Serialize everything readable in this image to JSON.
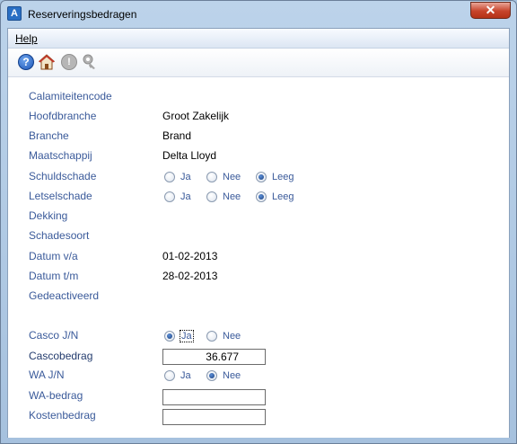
{
  "window": {
    "title": "Reserveringsbedragen",
    "close_label": "✕"
  },
  "menu": {
    "help_label": "Help"
  },
  "toolbar": {
    "icons": [
      "help-icon",
      "home-icon",
      "info-icon",
      "key-icon"
    ]
  },
  "form": {
    "calamiteitencode": {
      "label": "Calamiteitencode",
      "value": ""
    },
    "hoofdbranche": {
      "label": "Hoofdbranche",
      "value": "Groot Zakelijk"
    },
    "branche": {
      "label": "Branche",
      "value": "Brand"
    },
    "maatschappij": {
      "label": "Maatschappij",
      "value": "Delta Lloyd"
    },
    "schuldschade": {
      "label": "Schuldschade",
      "options": [
        "Ja",
        "Nee",
        "Leeg"
      ],
      "selected": "Leeg"
    },
    "letselschade": {
      "label": "Letselschade",
      "options": [
        "Ja",
        "Nee",
        "Leeg"
      ],
      "selected": "Leeg"
    },
    "dekking": {
      "label": "Dekking",
      "value": ""
    },
    "schadesoort": {
      "label": "Schadesoort",
      "value": ""
    },
    "datum_va": {
      "label": "Datum v/a",
      "value": "01-02-2013"
    },
    "datum_tm": {
      "label": "Datum t/m",
      "value": "28-02-2013"
    },
    "gedeactiveerd": {
      "label": "Gedeactiveerd",
      "value": ""
    },
    "casco_jn": {
      "label": "Casco J/N",
      "options": [
        "Ja",
        "Nee"
      ],
      "selected": "Ja"
    },
    "cascobedrag": {
      "label": "Cascobedrag",
      "value": "36.677"
    },
    "wa_jn": {
      "label": "WA J/N",
      "options": [
        "Ja",
        "Nee"
      ],
      "selected": "Nee"
    },
    "wa_bedrag": {
      "label": "WA-bedrag",
      "value": ""
    },
    "kostenbedrag": {
      "label": "Kostenbedrag",
      "value": ""
    }
  }
}
